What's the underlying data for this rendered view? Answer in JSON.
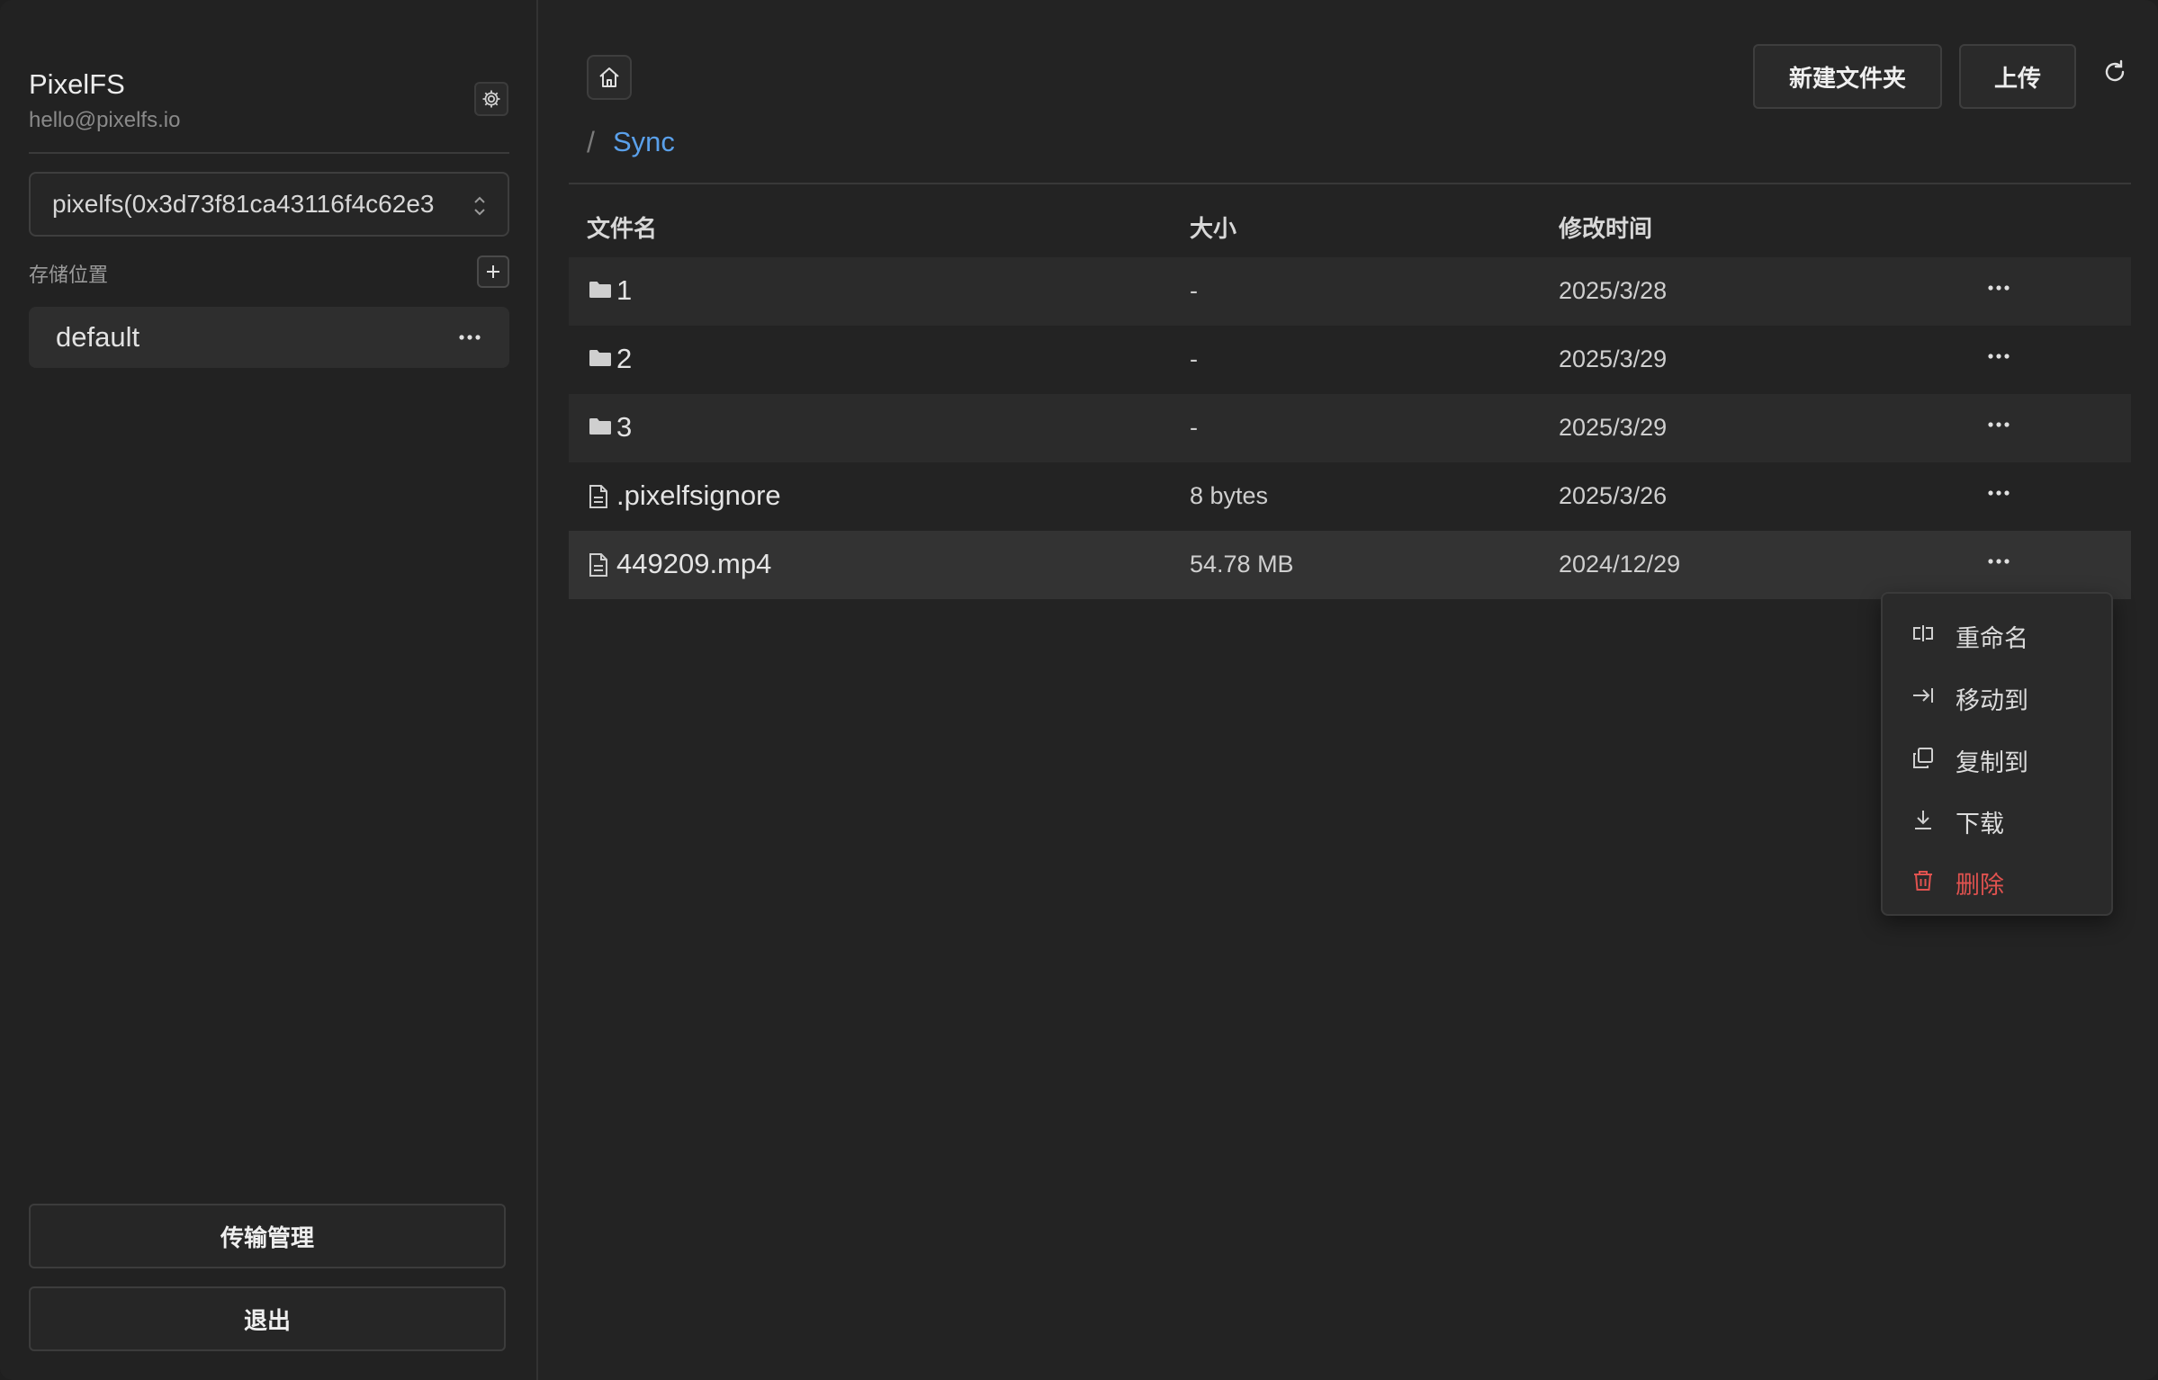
{
  "window": {
    "traffic_lights": [
      "close",
      "minimize",
      "maximize"
    ]
  },
  "sidebar": {
    "app_name": "PixelFS",
    "email": "hello@pixelfs.io",
    "account_select": {
      "value": "pixelfs(0x3d73f81ca43116f4c62e3"
    },
    "storage_label": "存储位置",
    "storage_items": [
      {
        "name": "default"
      }
    ],
    "transfer_button": "传输管理",
    "logout_button": "退出"
  },
  "toolbar": {
    "new_folder_button": "新建文件夹",
    "upload_button": "上传"
  },
  "breadcrumb": {
    "separator": "/",
    "current": "Sync"
  },
  "table": {
    "columns": {
      "name": "文件名",
      "size": "大小",
      "modified": "修改时间"
    },
    "rows": [
      {
        "type": "folder",
        "name": "1",
        "size": "-",
        "modified": "2025/3/28"
      },
      {
        "type": "folder",
        "name": "2",
        "size": "-",
        "modified": "2025/3/29"
      },
      {
        "type": "folder",
        "name": "3",
        "size": "-",
        "modified": "2025/3/29"
      },
      {
        "type": "file",
        "name": ".pixelfsignore",
        "size": "8 bytes",
        "modified": "2025/3/26"
      },
      {
        "type": "file",
        "name": "449209.mp4",
        "size": "54.78 MB",
        "modified": "2024/12/29"
      }
    ]
  },
  "context_menu": {
    "items": [
      {
        "label": "重命名",
        "icon": "rename-icon"
      },
      {
        "label": "移动到",
        "icon": "move-to-icon"
      },
      {
        "label": "复制到",
        "icon": "copy-to-icon"
      },
      {
        "label": "下载",
        "icon": "download-icon"
      },
      {
        "label": "删除",
        "icon": "trash-icon",
        "danger": true
      }
    ]
  },
  "colors": {
    "background": "#232323",
    "accent": "#5aa0ea",
    "danger": "#e0524f"
  }
}
